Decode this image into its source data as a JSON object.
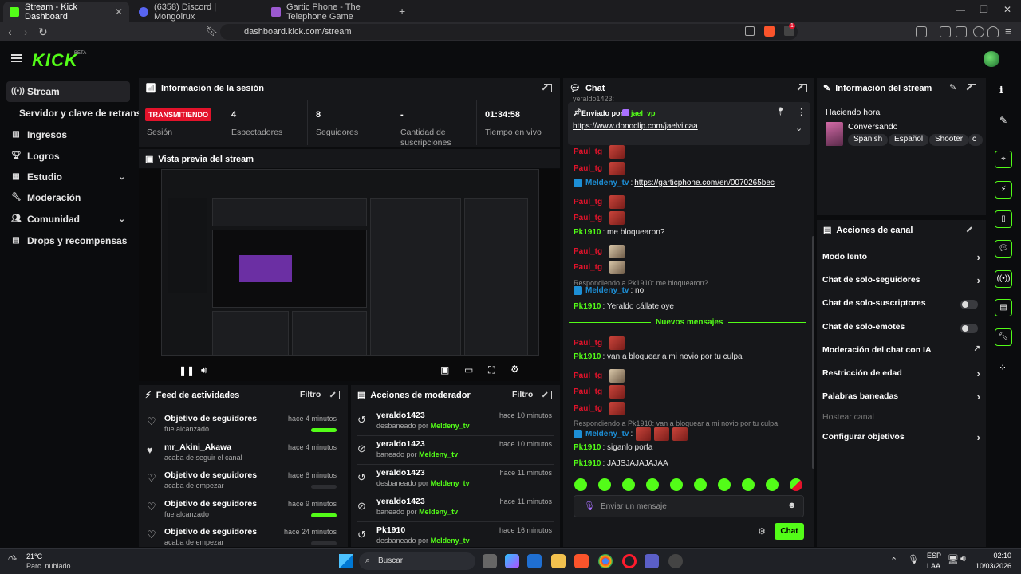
{
  "browser": {
    "tabs": [
      {
        "label": "Stream - Kick Dashboard",
        "active": true
      },
      {
        "label": "(6358) Discord | Mongolrux",
        "active": false
      },
      {
        "label": "Gartic Phone - The Telephone Game",
        "active": false
      }
    ],
    "url": "dashboard.kick.com/stream",
    "ext_badge": "1"
  },
  "header": {
    "logo": "KICK",
    "beta": "BETA"
  },
  "sidebar": {
    "items": [
      {
        "label": "Stream",
        "icon": "broadcast-icon"
      },
      {
        "label": "Servidor y clave de retransm",
        "icon": ""
      },
      {
        "label": "Ingresos",
        "icon": "chart-icon"
      },
      {
        "label": "Logros",
        "icon": "trophy-icon"
      },
      {
        "label": "Estudio",
        "icon": "grid-icon"
      },
      {
        "label": "Moderación",
        "icon": "wrench-icon"
      },
      {
        "label": "Comunidad",
        "icon": "people-icon"
      },
      {
        "label": "Drops y recompensas",
        "icon": "gift-icon"
      }
    ]
  },
  "session": {
    "title": "Información de la sesión",
    "badge": "TRANSMITIENDO",
    "stats": [
      {
        "value": "",
        "label": "Sesión"
      },
      {
        "value": "4",
        "label": "Espectadores"
      },
      {
        "value": "8",
        "label": "Seguidores"
      },
      {
        "value": "-",
        "label": "Cantidad de suscripciones"
      },
      {
        "value": "01:34:58",
        "label": "Tiempo en vivo"
      }
    ]
  },
  "preview": {
    "title": "Vista previa del stream"
  },
  "activity": {
    "title": "Feed de actividades",
    "filter": "Filtro",
    "rows": [
      {
        "title": "Objetivo de seguidores",
        "sub": "fue alcanzado",
        "time": "hace 4 minutos",
        "progress": 1.0
      },
      {
        "title": "mr_Akini_Akawa",
        "sub": "acaba de seguir el canal",
        "time": "hace 4 minutos",
        "progress": null
      },
      {
        "title": "Objetivo de seguidores",
        "sub": "acaba de empezar",
        "time": "hace 8 minutos",
        "progress": 0
      },
      {
        "title": "Objetivo de seguidores",
        "sub": "fue alcanzado",
        "time": "hace 9 minutos",
        "progress": 1.0
      },
      {
        "title": "Objetivo de seguidores",
        "sub": "acaba de empezar",
        "time": "hace 24 minutos",
        "progress": 0
      }
    ]
  },
  "modactions": {
    "title": "Acciones de moderador",
    "filter": "Filtro",
    "rows": [
      {
        "user": "yeraldo1423",
        "action": "desbaneado por",
        "mod": "Meldeny_tv",
        "time": "hace 10 minutos"
      },
      {
        "user": "yeraldo1423",
        "action": "baneado por",
        "mod": "Meldeny_tv",
        "time": "hace 10 minutos"
      },
      {
        "user": "yeraldo1423",
        "action": "desbaneado por",
        "mod": "Meldeny_tv",
        "time": "hace 11 minutos"
      },
      {
        "user": "yeraldo1423",
        "action": "baneado por",
        "mod": "Meldeny_tv",
        "time": "hace 11 minutos"
      },
      {
        "user": "Pk1910",
        "action": "desbaneado por",
        "mod": "Meldeny_tv",
        "time": "hace 16 minutos"
      }
    ]
  },
  "chat": {
    "title": "Chat",
    "pinned_by_label": "Enviado por",
    "pinned_by": "jael_vp",
    "pinned_link": "https://www.donoclip.com/jaelvilcaa",
    "cut_user": "yeraldo1423:",
    "new_messages": "Nuevos mensajes",
    "messages": [
      {
        "user": "Paul_tg",
        "text": ":"
      },
      {
        "user": "Paul_tg",
        "text": ":"
      },
      {
        "user": "Meldeny_tv",
        "text": ": ",
        "link": "https://garticphone.com/en/0070265bec"
      },
      {
        "user": "Paul_tg",
        "text": ":"
      },
      {
        "user": "Paul_tg",
        "text": ":"
      },
      {
        "user": "Pk1910",
        "text": ": me bloquearon?"
      },
      {
        "user": "Paul_tg",
        "text": ":"
      },
      {
        "user": "Paul_tg",
        "text": ":"
      },
      {
        "reply": "Respondiendo a Pk1910: me bloquearon?"
      },
      {
        "user": "Meldeny_tv",
        "text": ": no"
      },
      {
        "user": "Pk1910",
        "text": ": Yeraldo cállate oye"
      },
      {
        "user": "Paul_tg",
        "text": ":"
      },
      {
        "user": "Pk1910",
        "text": ": van a bloquear a mi novio por tu culpa"
      },
      {
        "user": "Paul_tg",
        "text": ":"
      },
      {
        "user": "Paul_tg",
        "text": ":"
      },
      {
        "user": "Paul_tg",
        "text": ":"
      },
      {
        "reply": "Respondiendo a Pk1910: van a bloquear a mi novio por tu culpa"
      },
      {
        "user": "Meldeny_tv",
        "text": ":"
      },
      {
        "user": "Pk1910",
        "text": ": siganlo porfa"
      },
      {
        "user": "Pk1910",
        "text": ": JAJSJAJAJAJAA"
      }
    ],
    "input_placeholder": "Enviar un mensaje",
    "send_label": "Chat",
    "colors": {
      "paul": "#e3132b",
      "pk": "#53fc18",
      "meldeny": "#1d8fd6"
    }
  },
  "stream_info": {
    "title": "Información del stream",
    "stream_title": "Haciendo hora",
    "category": "Conversando",
    "tags": [
      "Spanish",
      "Español",
      "Shooter",
      "c"
    ]
  },
  "channel_actions": {
    "title": "Acciones de canal",
    "items": [
      {
        "label": "Modo lento",
        "control": "arrow"
      },
      {
        "label": "Chat de solo-seguidores",
        "control": "arrow"
      },
      {
        "label": "Chat de solo-suscriptores",
        "control": "toggle"
      },
      {
        "label": "Chat de solo-emotes",
        "control": "toggle"
      },
      {
        "label": "Moderación del chat con IA",
        "control": "external"
      },
      {
        "label": "Restricción de edad",
        "control": "arrow"
      },
      {
        "label": "Palabras baneadas",
        "control": "arrow"
      },
      {
        "label": "Hostear canal",
        "control": "disabled"
      },
      {
        "label": "Configurar objetivos",
        "control": "arrow"
      }
    ]
  },
  "taskbar": {
    "weather_temp": "21°C",
    "weather_desc": "Parc. nublado",
    "search": "Buscar",
    "lang": "ESP",
    "lang2": "LAA",
    "time": "02:10",
    "date": "10/03/2026"
  }
}
